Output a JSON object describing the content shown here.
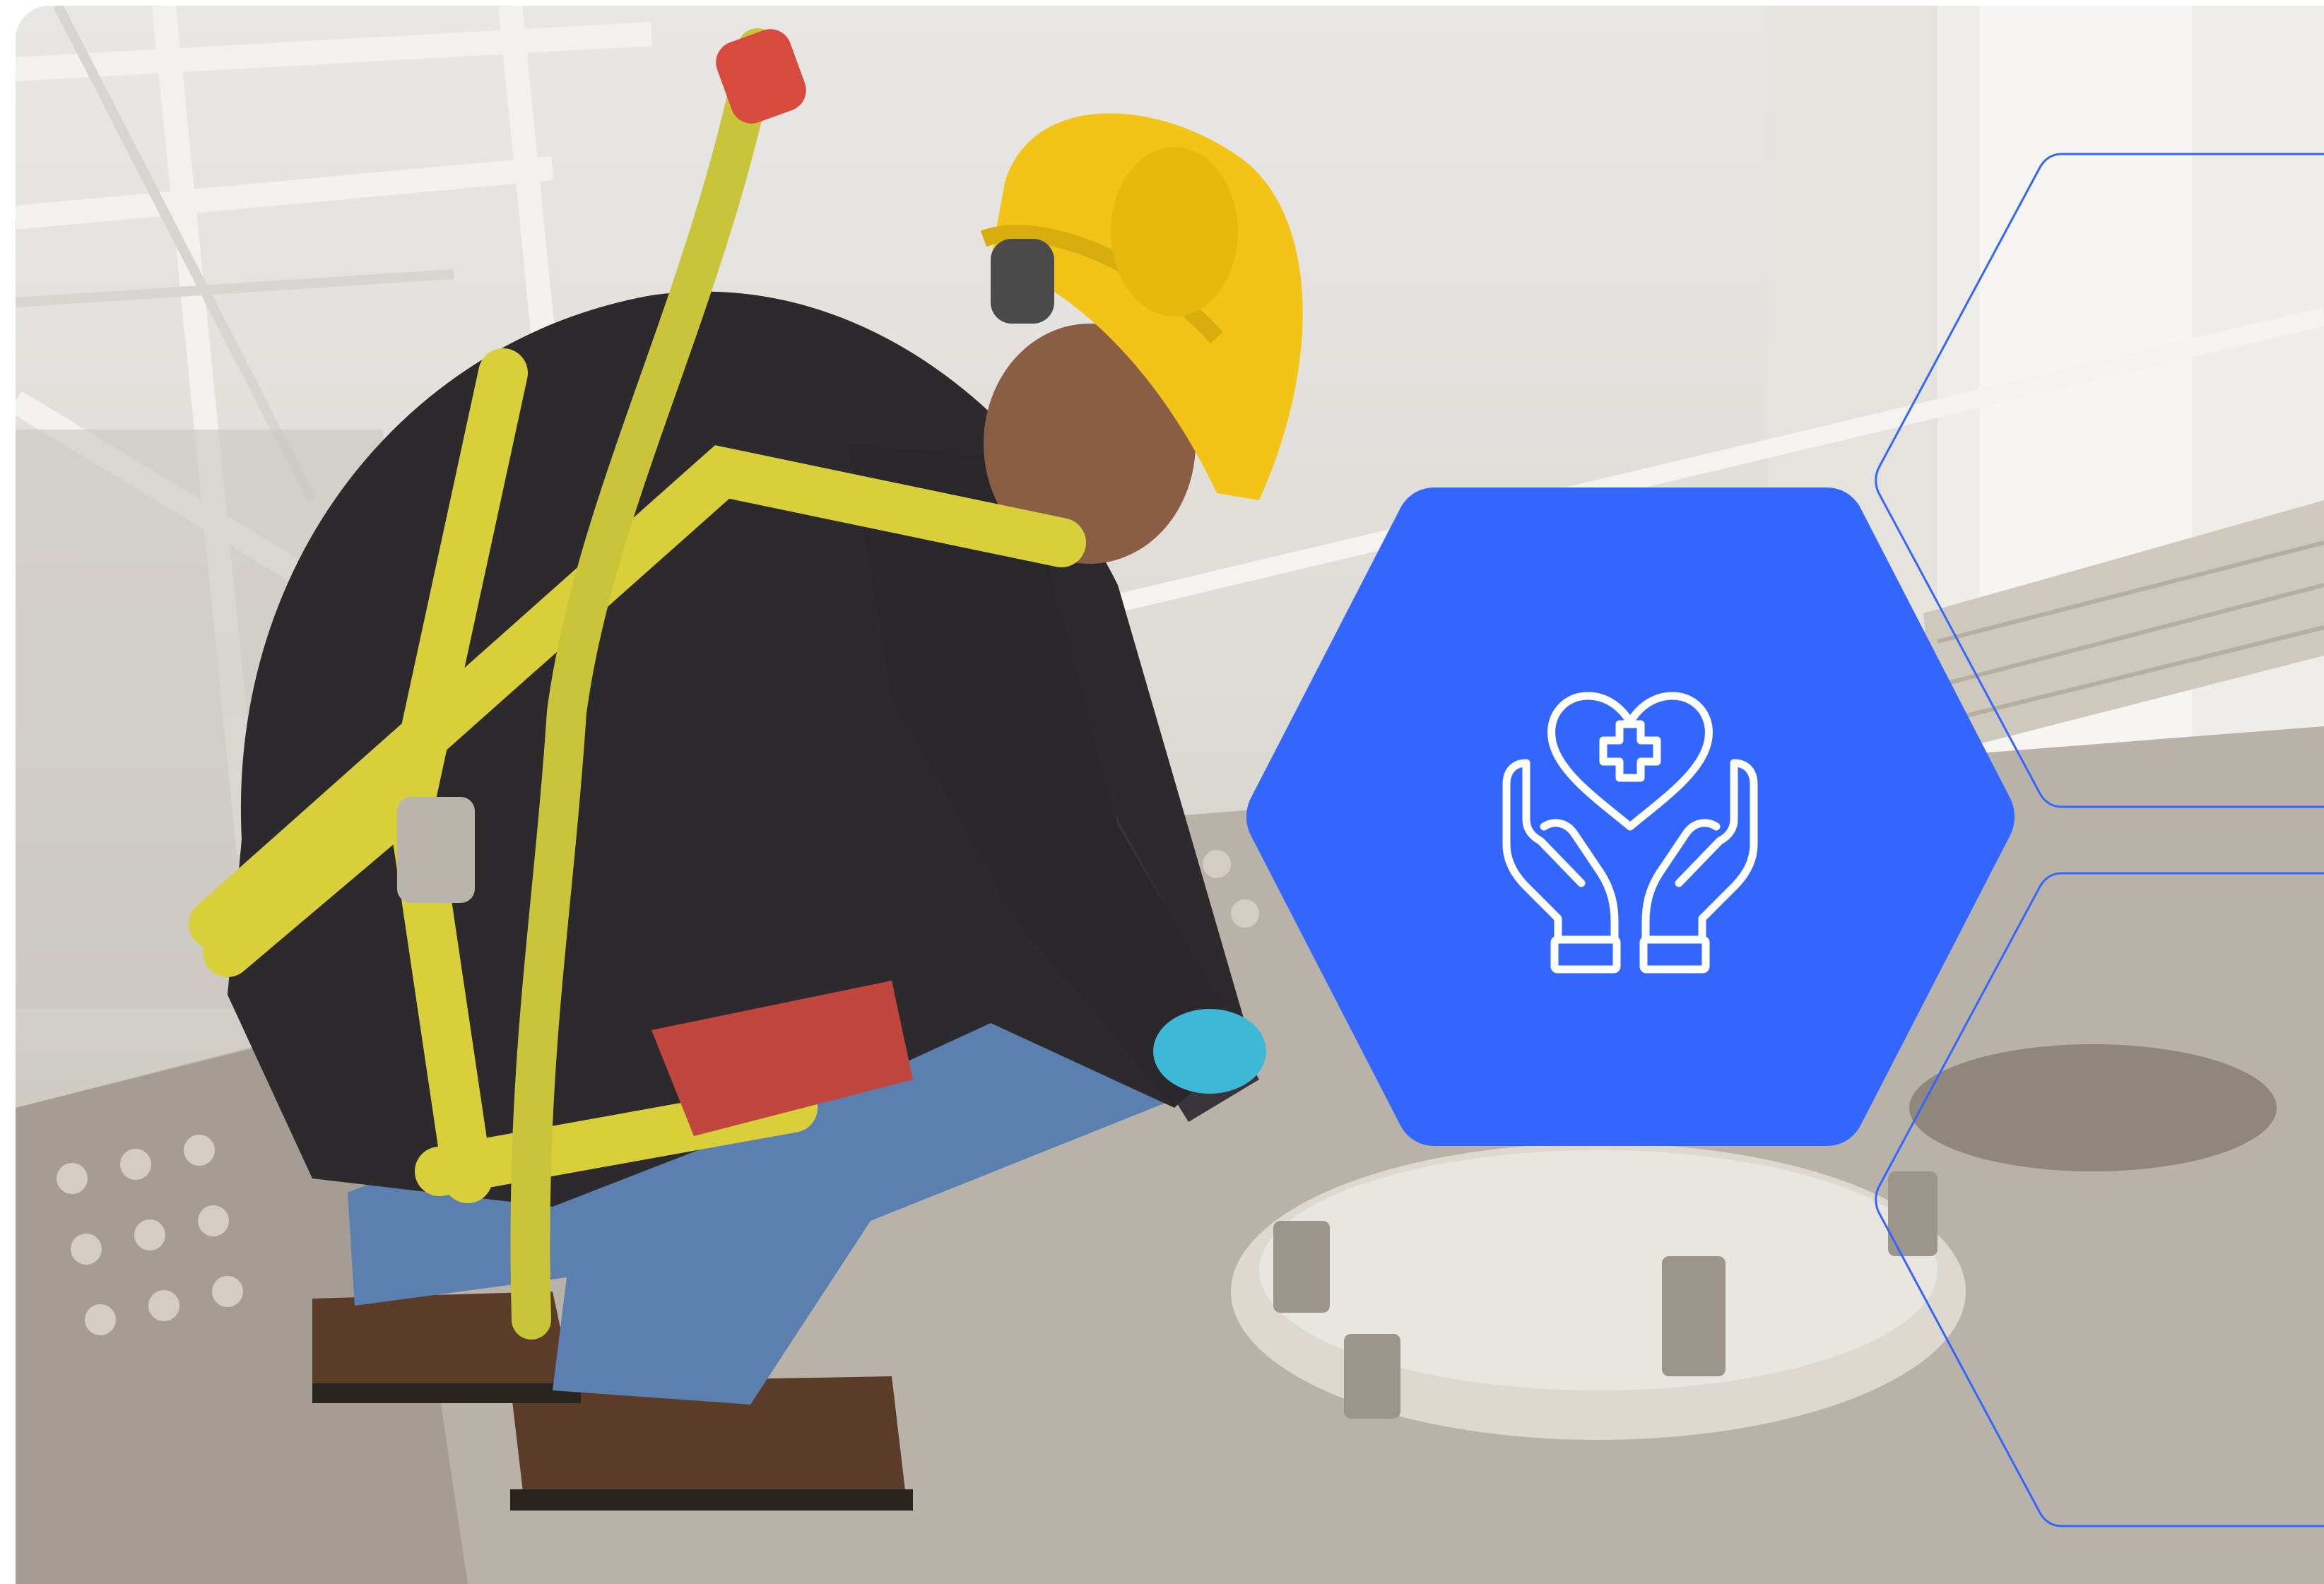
{
  "photo": {
    "subject": "worker-in-safety-harness",
    "hardhat_color": "#f2c418",
    "harness_color": "#d9cf3a"
  },
  "badge": {
    "icon": "hands-holding-heart-plus-icon",
    "fill_color": "#3366ff",
    "icon_color": "#ffffff"
  },
  "outline_color": "#3366ff"
}
